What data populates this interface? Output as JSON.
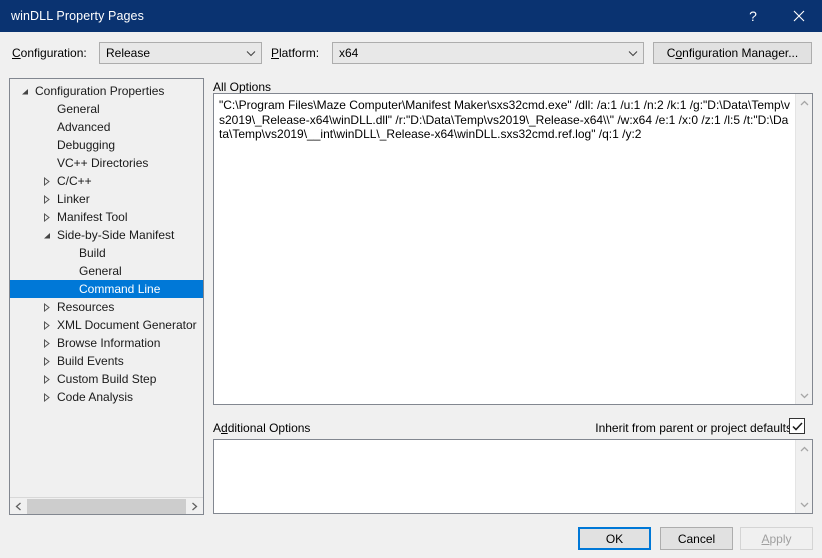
{
  "window": {
    "title": "winDLL Property Pages",
    "help_icon": "?",
    "close_icon": "close-icon"
  },
  "config_bar": {
    "configuration_label": "Configuration:",
    "configuration_label_accel": "C",
    "configuration_value": "Release",
    "platform_label": "Platform:",
    "platform_label_accel": "P",
    "platform_value": "x64",
    "configuration_manager_label": "Configuration Manager...",
    "configuration_manager_accel": "o"
  },
  "tree": {
    "items": [
      {
        "label": "Configuration Properties",
        "indent": 0,
        "expander": "expanded",
        "selected": false
      },
      {
        "label": "General",
        "indent": 1,
        "expander": "none",
        "selected": false
      },
      {
        "label": "Advanced",
        "indent": 1,
        "expander": "none",
        "selected": false
      },
      {
        "label": "Debugging",
        "indent": 1,
        "expander": "none",
        "selected": false
      },
      {
        "label": "VC++ Directories",
        "indent": 1,
        "expander": "none",
        "selected": false
      },
      {
        "label": "C/C++",
        "indent": 1,
        "expander": "collapsed",
        "selected": false
      },
      {
        "label": "Linker",
        "indent": 1,
        "expander": "collapsed",
        "selected": false
      },
      {
        "label": "Manifest Tool",
        "indent": 1,
        "expander": "collapsed",
        "selected": false
      },
      {
        "label": "Side-by-Side Manifest",
        "indent": 1,
        "expander": "expanded",
        "selected": false
      },
      {
        "label": "Build",
        "indent": 2,
        "expander": "none",
        "selected": false
      },
      {
        "label": "General",
        "indent": 2,
        "expander": "none",
        "selected": false
      },
      {
        "label": "Command Line",
        "indent": 2,
        "expander": "none",
        "selected": true
      },
      {
        "label": "Resources",
        "indent": 1,
        "expander": "collapsed",
        "selected": false
      },
      {
        "label": "XML Document Generator",
        "indent": 1,
        "expander": "collapsed",
        "selected": false
      },
      {
        "label": "Browse Information",
        "indent": 1,
        "expander": "collapsed",
        "selected": false
      },
      {
        "label": "Build Events",
        "indent": 1,
        "expander": "collapsed",
        "selected": false
      },
      {
        "label": "Custom Build Step",
        "indent": 1,
        "expander": "collapsed",
        "selected": false
      },
      {
        "label": "Code Analysis",
        "indent": 1,
        "expander": "collapsed",
        "selected": false
      }
    ]
  },
  "all_options": {
    "label": "All Options",
    "value": "\"C:\\Program Files\\Maze Computer\\Manifest Maker\\sxs32cmd.exe\" /dll: /a:1 /u:1 /n:2 /k:1 /g:\"D:\\Data\\Temp\\vs2019\\_Release-x64\\winDLL.dll\" /r:\"D:\\Data\\Temp\\vs2019\\_Release-x64\\\\\" /w:x64 /e:1 /x:0 /z:1 /l:5 /t:\"D:\\Data\\Temp\\vs2019\\__int\\winDLL\\_Release-x64\\winDLL.sxs32cmd.ref.log\" /q:1 /y:2",
    "scroll_up_icon": "chevron-up-icon",
    "scroll_down_icon": "chevron-down-icon"
  },
  "additional_options": {
    "label": "Additional Options",
    "label_accel": "d",
    "value": "",
    "inherit_label": "Inherit from parent or project defaults",
    "inherit_checked": true,
    "check_icon": "checkmark-icon"
  },
  "footer": {
    "ok_label": "OK",
    "cancel_label": "Cancel",
    "apply_label": "Apply",
    "apply_accel": "A",
    "apply_enabled": false
  },
  "colors": {
    "titlebar": "#0a3371",
    "selection": "#0078d7",
    "focus_border": "#0078d7",
    "dialog_bg": "#f0f0f0"
  }
}
